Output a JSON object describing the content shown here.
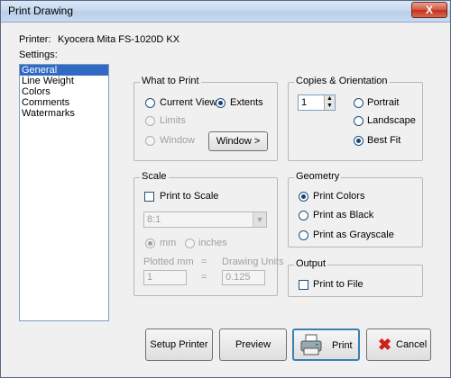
{
  "window": {
    "title": "Print Drawing",
    "close_glyph": "X"
  },
  "printer": {
    "label": "Printer:",
    "name": "Kyocera Mita FS-1020D KX"
  },
  "settings": {
    "label": "Settings:",
    "items": [
      "General",
      "Line Weight",
      "Colors",
      "Comments",
      "Watermarks"
    ],
    "selected": "General"
  },
  "what_to_print": {
    "title": "What to Print",
    "current_view": "Current View",
    "extents": "Extents",
    "limits": "Limits",
    "window": "Window",
    "window_button": "Window >",
    "selected": "Extents"
  },
  "copies": {
    "title": "Copies & Orientation",
    "count": "1",
    "portrait": "Portrait",
    "landscape": "Landscape",
    "best_fit": "Best Fit",
    "selected": "Best Fit"
  },
  "scale": {
    "title": "Scale",
    "print_to_scale": "Print to Scale",
    "print_to_scale_checked": false,
    "ratio": "8:1",
    "mm": "mm",
    "inches": "inches",
    "unit_selected": "mm",
    "plotted_label": "Plotted mm",
    "equals": "=",
    "drawing_units_label": "Drawing Units",
    "plotted_value": "1",
    "drawing_value": "0.125"
  },
  "geometry": {
    "title": "Geometry",
    "print_colors": "Print Colors",
    "print_black": "Print as Black",
    "print_grayscale": "Print as Grayscale",
    "selected": "Print Colors"
  },
  "output": {
    "title": "Output",
    "print_to_file": "Print to File",
    "print_to_file_checked": false
  },
  "buttons": {
    "setup_printer": "Setup Printer",
    "preview": "Preview",
    "print": "Print",
    "cancel": "Cancel"
  },
  "colors": {
    "selection": "#316ac5",
    "cancel_x": "#d0201a",
    "titlebar": "#c5d7ee"
  }
}
